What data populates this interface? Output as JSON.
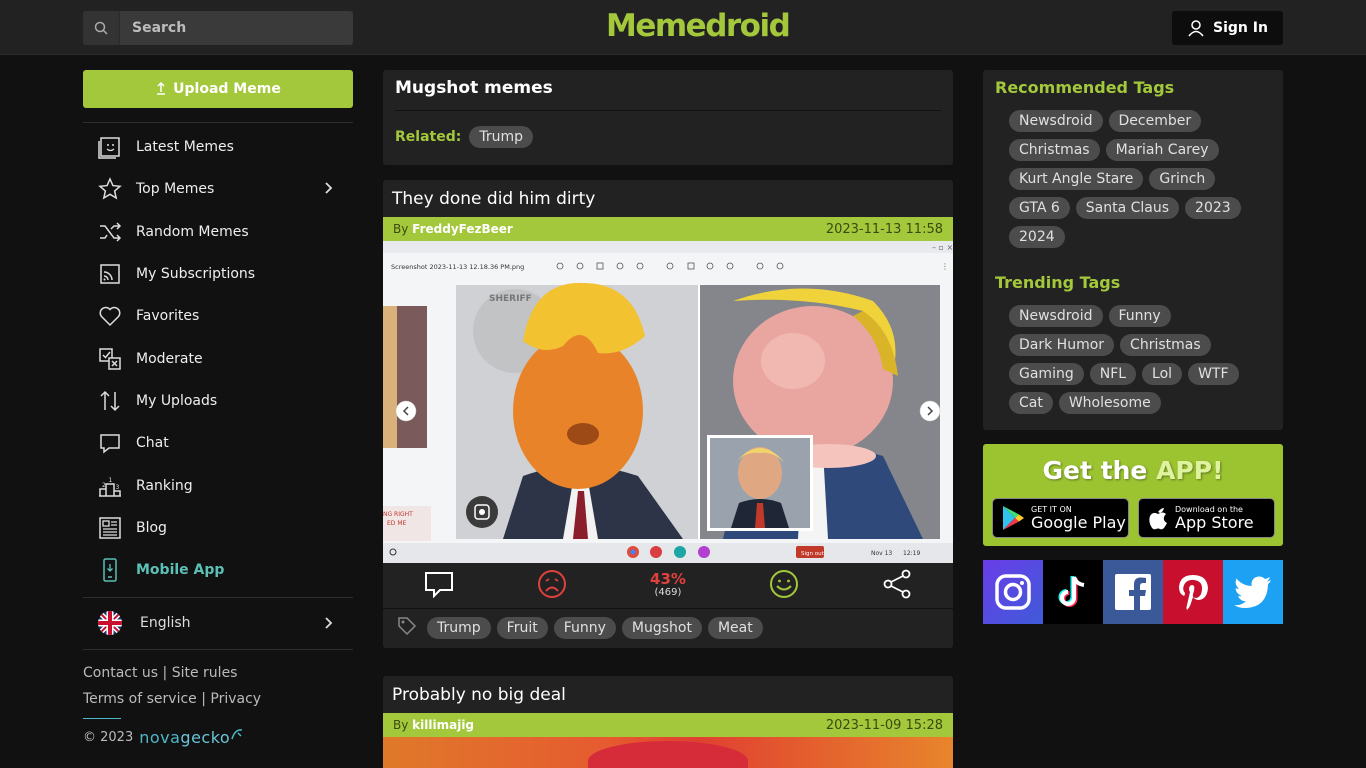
{
  "header": {
    "search_placeholder": "Search",
    "logo": "Memedroid",
    "signin_label": "Sign In"
  },
  "sidebar": {
    "upload_label": "Upload Meme",
    "items": [
      {
        "label": "Latest Memes",
        "icon": "latest-memes-icon"
      },
      {
        "label": "Top Memes",
        "icon": "star-icon"
      },
      {
        "label": "Random Memes",
        "icon": "shuffle-icon"
      },
      {
        "label": "My Subscriptions",
        "icon": "subscriptions-icon"
      },
      {
        "label": "Favorites",
        "icon": "heart-icon"
      },
      {
        "label": "Moderate",
        "icon": "moderate-icon"
      },
      {
        "label": "My Uploads",
        "icon": "uploads-icon"
      },
      {
        "label": "Chat",
        "icon": "chat-icon"
      },
      {
        "label": "Ranking",
        "icon": "ranking-icon"
      },
      {
        "label": "Blog",
        "icon": "blog-icon"
      },
      {
        "label": "Mobile App",
        "icon": "mobile-icon"
      }
    ],
    "language": "English",
    "footer": {
      "contact": "Contact us",
      "site_rules": "Site rules",
      "terms": "Terms of service",
      "privacy": "Privacy",
      "copyright": "© 2023",
      "brand_a": "nova",
      "brand_b": "gecko"
    }
  },
  "main": {
    "title": "Mugshot memes",
    "related_label": "Related:",
    "related_tags": [
      "Trump"
    ],
    "posts": [
      {
        "title": "They done did him dirty",
        "by_label": "By",
        "author": "FreddyFezBeer",
        "date": "2023-11-13 11:58",
        "vote_pct": "43%",
        "vote_count": "(469)",
        "tags": [
          "Trump",
          "Fruit",
          "Funny",
          "Mugshot",
          "Meat"
        ],
        "screenshot_caption": "Screenshot 2023-11-13 12.18.36 PM.png",
        "taskbar_btn": "Sign out",
        "taskbar_date": "Nov 13",
        "taskbar_time": "12:19",
        "sheriff_text": "SHERIFF"
      },
      {
        "title": "Probably no big deal",
        "by_label": "By",
        "author": "killimajig",
        "date": "2023-11-09 15:28"
      }
    ]
  },
  "right": {
    "recommended_title": "Recommended Tags",
    "recommended": [
      "Newsdroid",
      "December",
      "Christmas",
      "Mariah Carey",
      "Kurt Angle Stare",
      "Grinch",
      "GTA 6",
      "Santa Claus",
      "2023",
      "2024"
    ],
    "trending_title": "Trending Tags",
    "trending": [
      "Newsdroid",
      "Funny",
      "Dark Humor",
      "Christmas",
      "Gaming",
      "NFL",
      "Lol",
      "WTF",
      "Cat",
      "Wholesome"
    ],
    "app": {
      "title_a": "Get the",
      "title_b": "APP!",
      "google_small": "GET IT ON",
      "google_big": "Google Play",
      "apple_small": "Download on the",
      "apple_big": "App Store"
    },
    "social": [
      "instagram-icon",
      "tiktok-icon",
      "facebook-icon",
      "pinterest-icon",
      "twitter-icon"
    ]
  },
  "colors": {
    "accent": "#a4c83b",
    "background": "#111111",
    "card": "#222222",
    "tag": "#4c4c4c",
    "mobile": "#5bc0b6",
    "vote": "#e0413c"
  }
}
